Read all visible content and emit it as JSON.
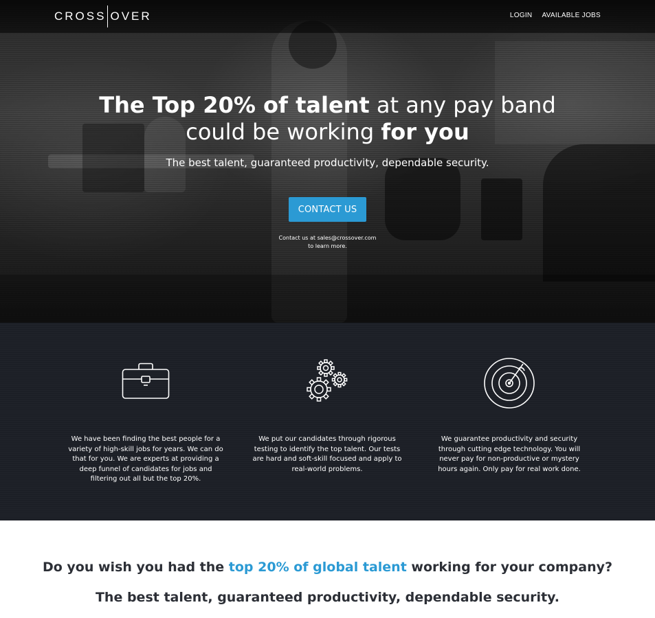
{
  "header": {
    "logo_left": "CROSS",
    "logo_right": "OVER",
    "nav": [
      {
        "label": "LOGIN"
      },
      {
        "label": "AVAILABLE JOBS"
      }
    ]
  },
  "hero": {
    "headline": {
      "line1_bold": "The Top 20% of talent",
      "line1_regular": " at any pay band",
      "line2_regular": "could be working ",
      "line2_bold": "for you"
    },
    "subheadline": "The best talent, guaranteed productivity, dependable security.",
    "cta_label": "CONTACT US",
    "contact_line1": "Contact us at sales@crossover.com",
    "contact_line2": "to learn more."
  },
  "features": [
    {
      "icon": "briefcase-icon",
      "text": "We have been finding the best people for a variety of high-skill jobs for years. We can do that for you. We are experts at providing a deep funnel of candidates for jobs and filtering out all but the top 20%."
    },
    {
      "icon": "gears-icon",
      "text": "We put our candidates through rigorous testing to identify the top talent. Our tests are hard and soft-skill focused and apply to real-world problems."
    },
    {
      "icon": "radar-icon",
      "text": "We guarantee productivity and security through cutting edge technology. You will never pay for non-productive or mystery hours again. Only pay for real work done."
    }
  ],
  "bottom": {
    "question_before": "Do you wish you had the ",
    "question_highlight": "top 20% of global talent",
    "question_after": " working for your company?",
    "tagline": "The best talent, guaranteed productivity, dependable security."
  },
  "colors": {
    "accent": "#2b9ad4",
    "features_bg": "#1c1f26",
    "text_dark": "#2c2f36"
  }
}
